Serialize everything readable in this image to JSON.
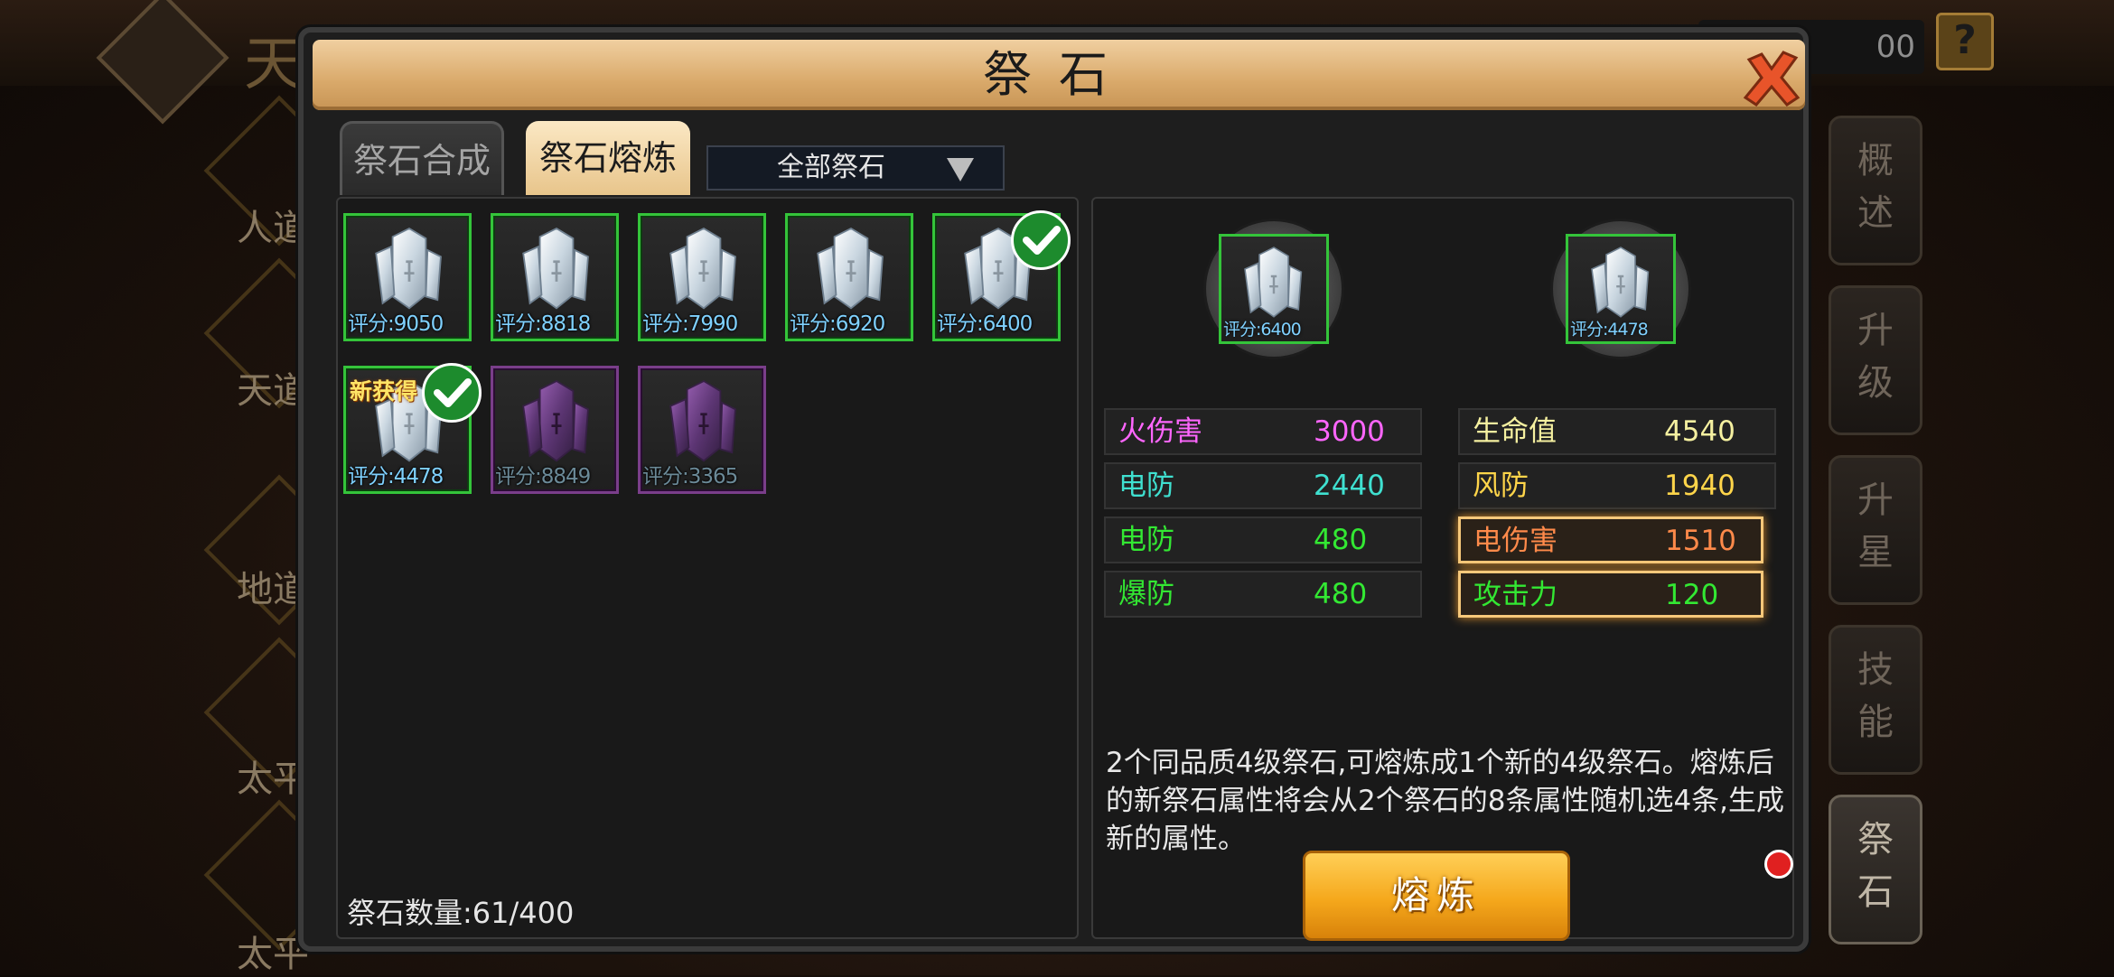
{
  "background": {
    "title_stub": "天",
    "coin_value": "00",
    "help_label": "?",
    "left_items": [
      "人道",
      "天道",
      "地道",
      "太平",
      "太平"
    ]
  },
  "side_tabs": [
    {
      "label": "概述",
      "active": false
    },
    {
      "label": "升级",
      "active": false
    },
    {
      "label": "升星",
      "active": false
    },
    {
      "label": "技能",
      "active": false
    },
    {
      "label": "祭石",
      "active": true
    }
  ],
  "dialog": {
    "title": "祭石",
    "tabs": [
      {
        "label": "祭石合成",
        "active": false
      },
      {
        "label": "祭石熔炼",
        "active": true
      }
    ],
    "filter_label": "全部祭石",
    "stones": [
      {
        "score": "评分:9050",
        "quality": "green",
        "checked": false,
        "new": false
      },
      {
        "score": "评分:8818",
        "quality": "green",
        "checked": false,
        "new": false
      },
      {
        "score": "评分:7990",
        "quality": "green",
        "checked": false,
        "new": false
      },
      {
        "score": "评分:6920",
        "quality": "green",
        "checked": false,
        "new": false
      },
      {
        "score": "评分:6400",
        "quality": "green",
        "checked": true,
        "new": false
      },
      {
        "score": "评分:4478",
        "quality": "green",
        "checked": true,
        "new": true
      },
      {
        "score": "评分:8849",
        "quality": "purple",
        "checked": false,
        "new": false
      },
      {
        "score": "评分:3365",
        "quality": "purple",
        "checked": false,
        "new": false
      }
    ],
    "new_badge": "新获得",
    "stone_count": "祭石数量:61/400",
    "compare": {
      "left": {
        "score": "评分:6400",
        "stats": [
          {
            "name": "火伤害",
            "value": "3000",
            "name_color": "#ff66ff",
            "value_color": "#ff66ff"
          },
          {
            "name": "电防",
            "value": "2440",
            "name_color": "#3fe0d0",
            "value_color": "#3fe0d0"
          },
          {
            "name": "电防",
            "value": "480",
            "name_color": "#33e833",
            "value_color": "#33e833"
          },
          {
            "name": "爆防",
            "value": "480",
            "name_color": "#33e833",
            "value_color": "#33e833"
          }
        ]
      },
      "right": {
        "score": "评分:4478",
        "stats": [
          {
            "name": "生命值",
            "value": "4540",
            "name_color": "#f5f0a0",
            "value_color": "#f5f0a0"
          },
          {
            "name": "风防",
            "value": "1940",
            "name_color": "#ffd54a",
            "value_color": "#ffd54a"
          },
          {
            "name": "电伤害",
            "value": "1510",
            "name_color": "#ff8a4a",
            "value_color": "#ff8a4a"
          },
          {
            "name": "攻击力",
            "value": "120",
            "name_color": "#33e833",
            "value_color": "#33e833"
          }
        ]
      }
    },
    "description": "2个同品质4级祭石,可熔炼成1个新的4级祭石。熔炼后的新祭石属性将会从2个祭石的8条属性随机选4条,生成新的属性。",
    "smelt_button": "熔炼"
  }
}
